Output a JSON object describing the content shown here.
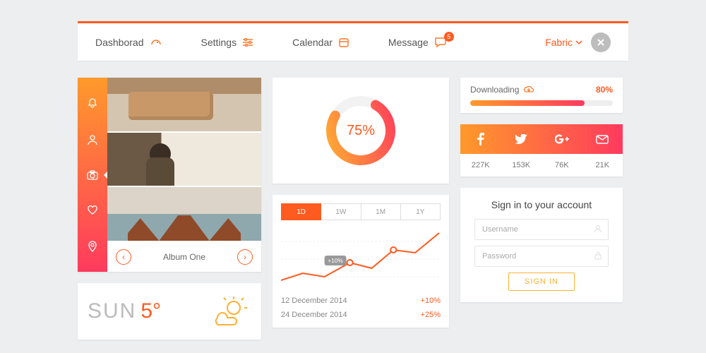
{
  "nav": {
    "items": [
      {
        "label": "Dashborad"
      },
      {
        "label": "Settings"
      },
      {
        "label": "Calendar"
      },
      {
        "label": "Message",
        "badge": "5"
      }
    ],
    "user": "Fabric"
  },
  "gallery": {
    "album": "Album One"
  },
  "weather": {
    "day": "SUN",
    "temp": "5°"
  },
  "donut": {
    "value": "75%"
  },
  "chart_data": {
    "type": "line",
    "title": "",
    "xlabel": "",
    "ylabel": "",
    "x": [
      0,
      1,
      2,
      3,
      4,
      5,
      6,
      7
    ],
    "values": [
      20,
      30,
      25,
      45,
      38,
      62,
      58,
      85
    ],
    "ylim": [
      0,
      100
    ],
    "annotation": "+10%"
  },
  "chart": {
    "ranges": [
      "1D",
      "1W",
      "1M",
      "1Y"
    ],
    "rows": [
      {
        "date": "12 December 2014",
        "change": "+10%"
      },
      {
        "date": "24 December 2014",
        "change": "+25%"
      }
    ]
  },
  "download": {
    "label": "Downloading",
    "percent": "80%"
  },
  "social": {
    "counts": [
      "227K",
      "153K",
      "76K",
      "21K"
    ]
  },
  "signin": {
    "title": "Sign in to your account",
    "user_ph": "Username",
    "pass_ph": "Password",
    "button": "SIGN IN"
  }
}
